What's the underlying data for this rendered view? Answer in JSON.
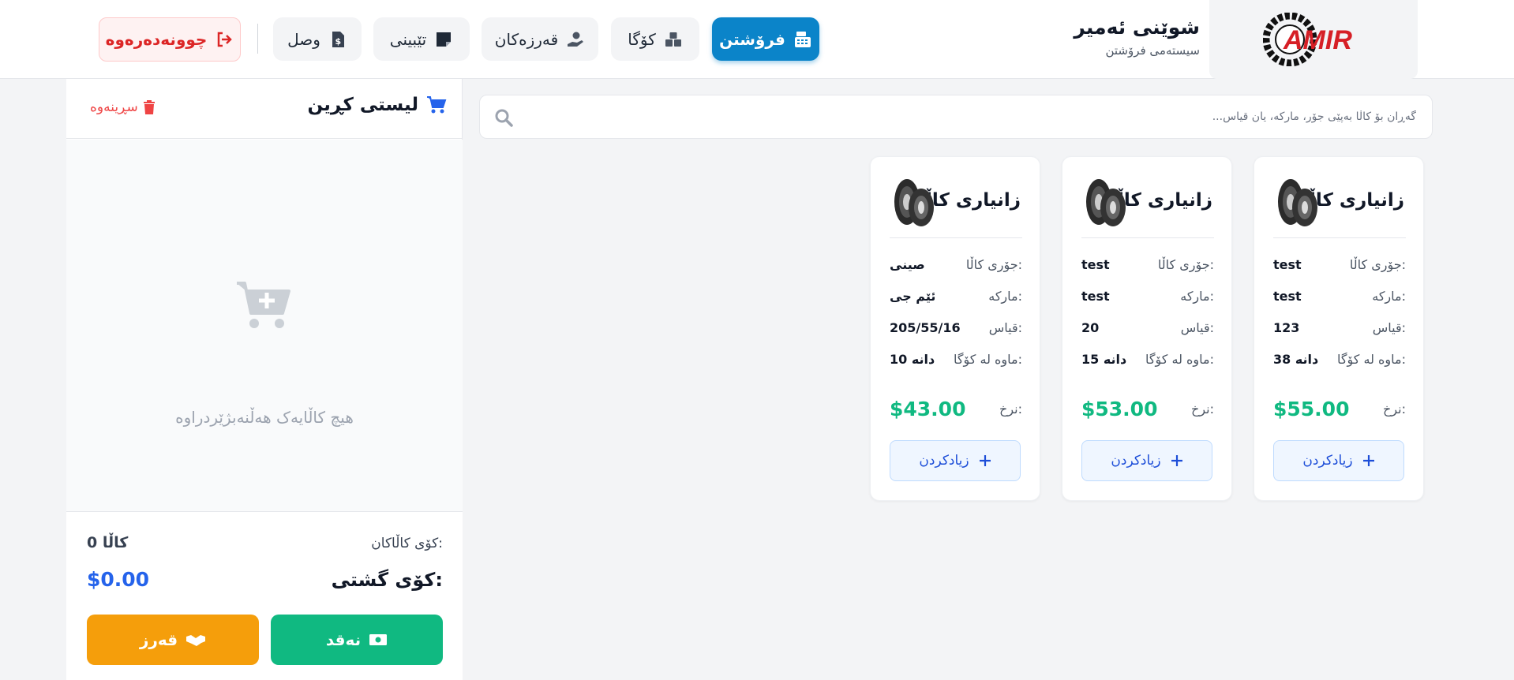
{
  "brand": {
    "logo_text": "AMIR",
    "title": "شوێنی ئەمیر",
    "subtitle": "سیستەمی فرۆشتن"
  },
  "nav": {
    "items": [
      {
        "label": "فرۆشتن",
        "icon": "cash-register-icon",
        "active": true
      },
      {
        "label": "کۆگا",
        "icon": "boxes-icon",
        "active": false
      },
      {
        "label": "قەرزەکان",
        "icon": "hand-holding-dollar-icon",
        "active": false
      },
      {
        "label": "تێبینی",
        "icon": "sticky-note-icon",
        "active": false
      },
      {
        "label": "وصل",
        "icon": "invoice-dollar-icon",
        "active": false
      }
    ],
    "logout_label": "چوونەدەرەوە"
  },
  "cart": {
    "title": "لیستی کڕین",
    "clear_label": "سڕینەوە",
    "empty_text": "هیچ کاڵایەک هەڵنەبژێردراوە",
    "count_label": "کۆی کاڵاکان:",
    "count_value": "0 کاڵا",
    "total_label": "کۆی گشتی:",
    "total_value": "$0.00",
    "cash_label": "نەقد",
    "credit_label": "قەرز"
  },
  "search": {
    "placeholder": "گەڕان بۆ کاڵا بەپێی جۆر، مارکە، یان قیاس..."
  },
  "products": [
    {
      "title": "زانیاری کاڵا",
      "type_label": "جۆری کاڵا:",
      "type_value": "test",
      "brand_label": "مارکە:",
      "brand_value": "test",
      "size_label": "قیاس:",
      "size_value": "123",
      "stock_label": "ماوە لە کۆگا:",
      "stock_value": "38 دانە",
      "price_label": "نرخ:",
      "price_value": "$55.00",
      "add_label": "زیادکردن"
    },
    {
      "title": "زانیاری کاڵا",
      "type_label": "جۆری کاڵا:",
      "type_value": "test",
      "brand_label": "مارکە:",
      "brand_value": "test",
      "size_label": "قیاس:",
      "size_value": "20",
      "stock_label": "ماوە لە کۆگا:",
      "stock_value": "15 دانە",
      "price_label": "نرخ:",
      "price_value": "$53.00",
      "add_label": "زیادکردن"
    },
    {
      "title": "زانیاری کاڵا",
      "type_label": "جۆری کاڵا:",
      "type_value": "صینی",
      "brand_label": "مارکە:",
      "brand_value": "ئێم جی",
      "size_label": "قیاس:",
      "size_value": "205/55/16",
      "stock_label": "ماوە لە کۆگا:",
      "stock_value": "10 دانە",
      "price_label": "نرخ:",
      "price_value": "$43.00",
      "add_label": "زیادکردن"
    }
  ],
  "colors": {
    "accent": "#0b84c9",
    "price": "#10b981",
    "danger": "#dc2626",
    "cash": "#10b981",
    "credit": "#f59e0b",
    "total": "#2563eb"
  }
}
